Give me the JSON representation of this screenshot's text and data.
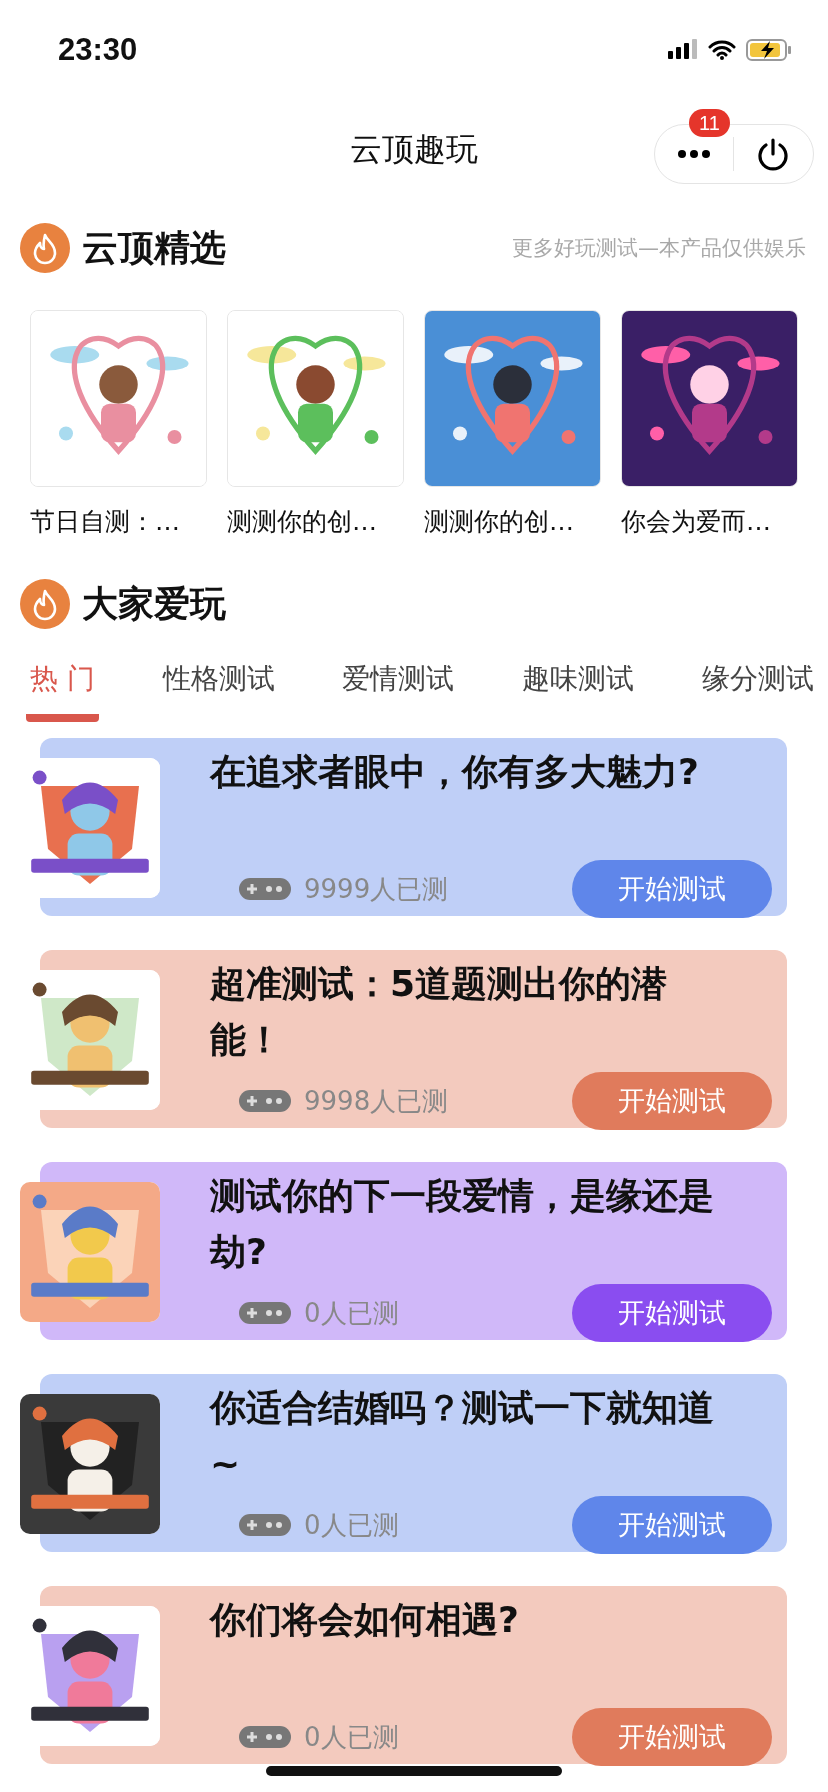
{
  "status_bar": {
    "time": "23:30"
  },
  "nav": {
    "title": "云顶趣玩",
    "badge": "11"
  },
  "featured": {
    "title": "云顶精选",
    "note": "更多好玩测试—本产品仅供娱乐",
    "items": [
      {
        "caption": "节日自测：…",
        "kind": "picture"
      },
      {
        "caption": "测测你的创…",
        "kind": "picture"
      },
      {
        "caption": "测测你的创…",
        "kind": "picture"
      },
      {
        "caption": "你会为爱而…",
        "kind": "picture"
      }
    ]
  },
  "popular": {
    "title": "大家爱玩",
    "tabs": [
      {
        "label": "热 门",
        "selected": true
      },
      {
        "label": "性格测试",
        "selected": false
      },
      {
        "label": "爱情测试",
        "selected": false
      },
      {
        "label": "趣味测试",
        "selected": false
      },
      {
        "label": "缘分测试",
        "selected": false
      }
    ],
    "cards": [
      {
        "title": "在追求者眼中，你有多大魅力?",
        "count": "9999人已测",
        "button": "开始测试",
        "color": "#5f86ea"
      },
      {
        "title": "超准测试：5道题测出你的潜能！",
        "count": "9998人已测",
        "button": "开始测试",
        "color": "#e07b5c"
      },
      {
        "title": "测试你的下一段爱情，是缘还是劫?",
        "count": "0人已测",
        "button": "开始测试",
        "color": "#8a4df0"
      },
      {
        "title": "你适合结婚吗？测试一下就知道~",
        "count": "0人已测",
        "button": "开始测试",
        "color": "#5f86ea"
      },
      {
        "title": "你们将会如何相遇?",
        "count": "0人已测",
        "button": "开始测试",
        "color": "#e07b5c"
      }
    ]
  }
}
